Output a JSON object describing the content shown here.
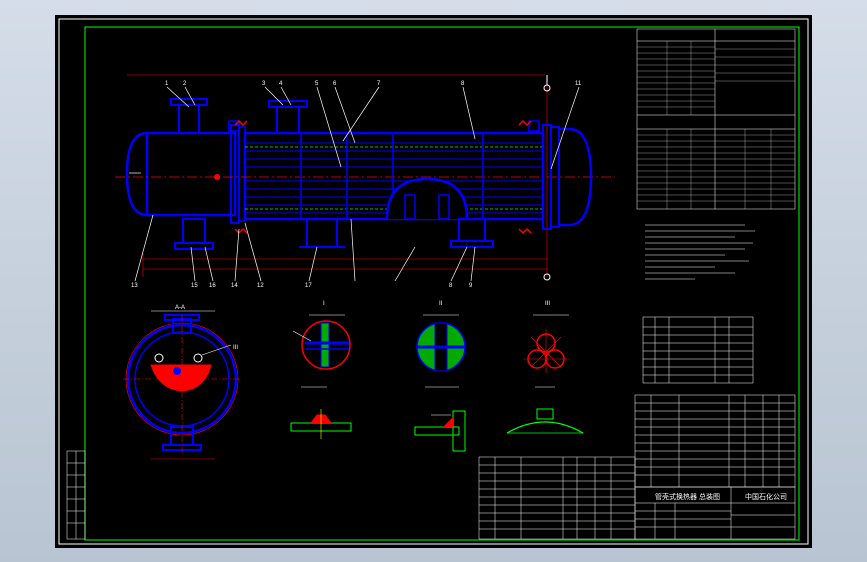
{
  "drawing": {
    "section_labels": [
      "I",
      "II",
      "III"
    ],
    "view_label": "A-A",
    "part_balloons": {
      "top": [
        "1",
        "2",
        "3",
        "4",
        "5",
        "6",
        "7",
        "8",
        "9",
        "10",
        "11"
      ],
      "bottom": [
        "13",
        "15",
        "16",
        "14",
        "12",
        "17",
        "8",
        "9"
      ]
    },
    "title_block_name": "管壳式换热器 总装图",
    "company": "中国石化公司"
  },
  "colors": {
    "background": "#000000",
    "frame": "#00ff00",
    "geometry": "#0000ff",
    "centerline": "#ff0000",
    "annotation": "#ffffff",
    "highlight_fill": "#ff0000",
    "section_fill": "#00aa00"
  }
}
